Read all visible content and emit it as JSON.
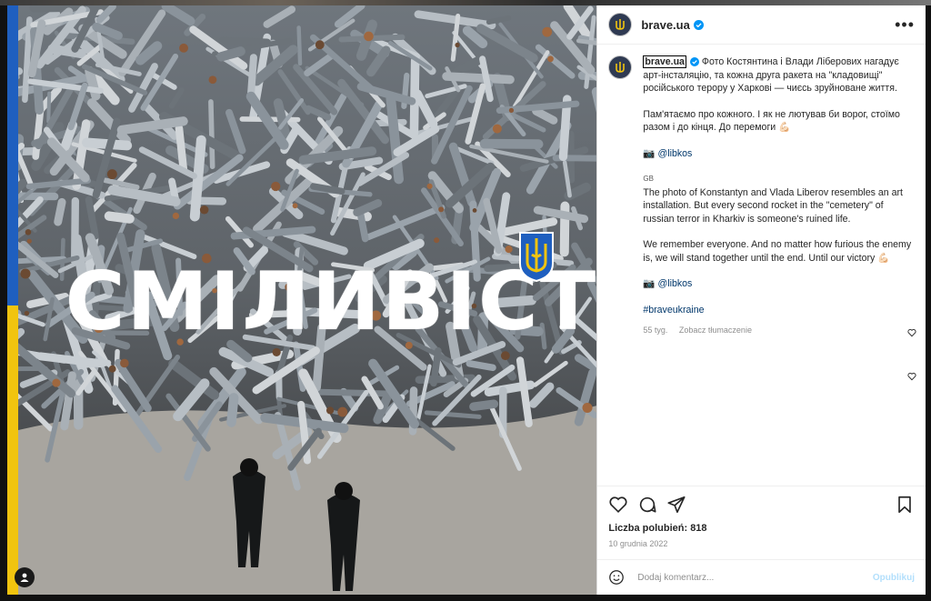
{
  "post": {
    "username": "brave.ua",
    "more_icon": "more-dots-icon",
    "photo_overlay_text": "СМІЛИВІСТЬ",
    "caption": {
      "username": "brave.ua",
      "uk_line1": "Фото Костянтина і Влади Ліберових нагадує арт-інсталяцію, та кожна друга ракета на \"кладовищі\" російського терору у Харкові — чиєсь зруйноване життя.",
      "uk_line2": "Пам'ятаємо про кожного. І як не лютував би ворог, стоїмо разом і до кінця. До перемоги 💪🏻",
      "uk_credit_icon": "📷",
      "uk_credit": "@libkos",
      "gb_flag": "GB",
      "en_line1": "The photo of Konstantyn and Vlada Liberov resembles an art installation. But every second rocket in the \"cemetery\" of russian terror in Kharkiv is someone's ruined life.",
      "en_line2": "We remember everyone. And no matter how furious the enemy is, we will stand together until the end. Until our victory 💪🏻",
      "en_credit_icon": "📷",
      "en_credit": "@libkos",
      "hashtag": "#braveukraine",
      "age": "55 tyg.",
      "translate": "Zobacz tłumaczenie"
    },
    "likes_label": "Liczba polubień: 818",
    "date": "10 grudnia 2022",
    "composer": {
      "placeholder": "Dodaj komentarz...",
      "publish": "Opublikuj"
    }
  },
  "colors": {
    "flag_blue": "#1f5fbf",
    "flag_yellow": "#f1c40f",
    "verified": "#0095f6",
    "link": "#00376b",
    "publish_disabled": "#b2dffc"
  }
}
